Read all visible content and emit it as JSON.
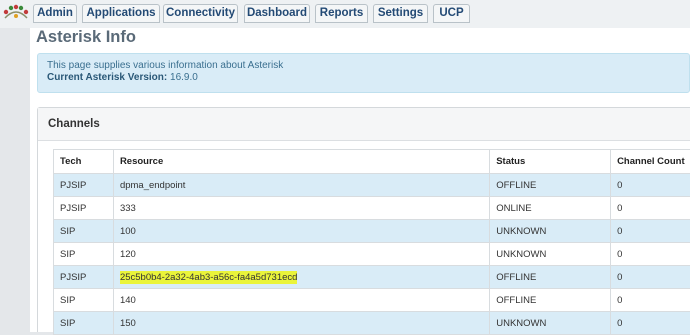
{
  "nav": {
    "items": [
      "Admin",
      "Applications",
      "Connectivity",
      "Dashboard",
      "Reports",
      "Settings",
      "UCP"
    ]
  },
  "page": {
    "title": "Asterisk Info",
    "info_text": "This page supplies various information about Asterisk",
    "version_label": "Current Asterisk Version:",
    "version_value": "16.9.0"
  },
  "channels": {
    "title": "Channels",
    "columns": [
      "Tech",
      "Resource",
      "Status",
      "Channel Count"
    ],
    "rows": [
      {
        "tech": "PJSIP",
        "resource": "dpma_endpoint",
        "status": "OFFLINE",
        "count": "0"
      },
      {
        "tech": "PJSIP",
        "resource": "333",
        "status": "ONLINE",
        "count": "0"
      },
      {
        "tech": "SIP",
        "resource": "100",
        "status": "UNKNOWN",
        "count": "0"
      },
      {
        "tech": "SIP",
        "resource": "120",
        "status": "UNKNOWN",
        "count": "0"
      },
      {
        "tech": "PJSIP",
        "resource": "25c5b0b4-2a32-4ab3-a56c-fa4a5d731ecd",
        "status": "OFFLINE",
        "count": "0",
        "highlighted": true
      },
      {
        "tech": "SIP",
        "resource": "140",
        "status": "OFFLINE",
        "count": "0"
      },
      {
        "tech": "SIP",
        "resource": "150",
        "status": "UNKNOWN",
        "count": "0"
      }
    ]
  },
  "colors": {
    "nav_text": "#234a75",
    "row_stripe": "#d9ecf7",
    "highlight": "#eaf43a"
  }
}
